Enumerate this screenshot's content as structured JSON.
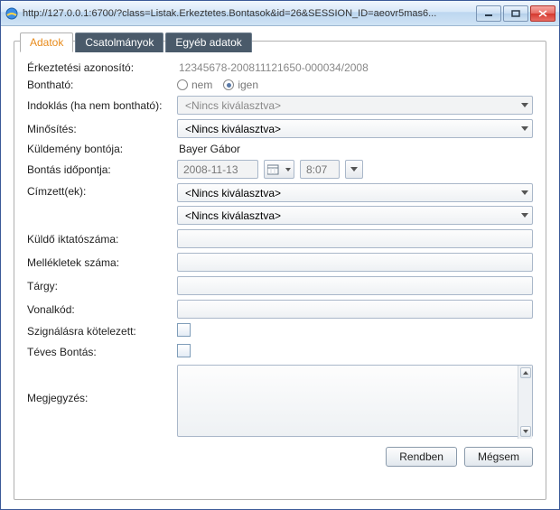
{
  "titlebar": {
    "url": "http://127.0.0.1:6700/?class=Listak.Erkeztetes.Bontasok&id=26&SESSION_ID=aeovr5mas6..."
  },
  "tabs": {
    "adatok": "Adatok",
    "csatolmanyok": "Csatolmányok",
    "egyeb": "Egyéb adatok"
  },
  "form": {
    "erkeztetesi_azonosito": {
      "label": "Érkeztetési azonosító:",
      "value": "12345678-200811121650-000034/2008"
    },
    "bonthato": {
      "label": "Bontható:",
      "nem": "nem",
      "igen": "igen",
      "selected": "igen"
    },
    "indoklas": {
      "label": "Indoklás (ha nem bontható):",
      "value": "<Nincs kiválasztva>"
    },
    "minosites": {
      "label": "Minősítés:",
      "value": "<Nincs kiválasztva>"
    },
    "kuldemeny_bontoja": {
      "label": "Küldemény bontója:",
      "value": "Bayer Gábor"
    },
    "bontas_idopontja": {
      "label": "Bontás időpontja:",
      "date": "2008-11-13",
      "time": "8:07"
    },
    "cimzettek": {
      "label": "Címzett(ek):",
      "value1": "<Nincs kiválasztva>",
      "value2": "<Nincs kiválasztva>"
    },
    "kuldo_iktatoszama": {
      "label": "Küldő iktatószáma:"
    },
    "mellekletek_szama": {
      "label": "Mellékletek száma:"
    },
    "targy": {
      "label": "Tárgy:"
    },
    "vonalkod": {
      "label": "Vonalkód:"
    },
    "szignalasra": {
      "label": "Szignálásra kötelezett:"
    },
    "teves_bontas": {
      "label": "Téves Bontás:"
    },
    "megjegyzes": {
      "label": "Megjegyzés:"
    }
  },
  "buttons": {
    "ok": "Rendben",
    "cancel": "Mégsem"
  }
}
